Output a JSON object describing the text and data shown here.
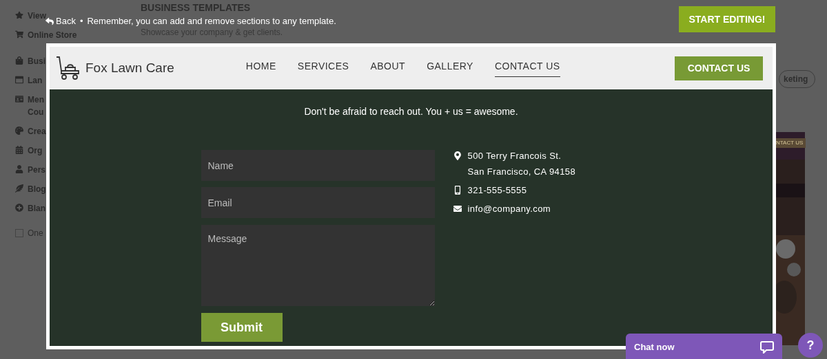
{
  "background": {
    "heading": "BUSINESS TEMPLATES",
    "subheading": "Showcase your company & get clients.",
    "sidebar": [
      {
        "label": "View"
      },
      {
        "label": "Online Store"
      },
      {
        "label": "Busi"
      },
      {
        "label": "Lan"
      },
      {
        "label": "Men\nCou"
      },
      {
        "label": "Crea"
      },
      {
        "label": "Org"
      },
      {
        "label": "Pers"
      },
      {
        "label": "Blog"
      },
      {
        "label": "Blan"
      }
    ],
    "checkbox": {
      "label": "One",
      "checked": false
    },
    "tag": "keting",
    "thumb_button": "NTACT US"
  },
  "topbar": {
    "back": "Back",
    "separator": "•",
    "note": "Remember, you can add and remove sections to any template.",
    "start_button": "START EDITING!"
  },
  "site": {
    "brand": "Fox Lawn Care",
    "nav": [
      {
        "label": "HOME",
        "selected": false
      },
      {
        "label": "SERVICES",
        "selected": false
      },
      {
        "label": "ABOUT",
        "selected": false
      },
      {
        "label": "GALLERY",
        "selected": false
      },
      {
        "label": "CONTACT US",
        "selected": true
      }
    ],
    "cta": "CONTACT US",
    "tagline": "Don't be afraid to reach out. You + us = awesome.",
    "form": {
      "name": {
        "placeholder": "Name"
      },
      "email": {
        "placeholder": "Email"
      },
      "message": {
        "placeholder": "Message"
      },
      "submit": "Submit"
    },
    "contact": [
      {
        "kind": "address",
        "lines": [
          "500 Terry Francois St.",
          "San Francisco, CA 94158"
        ]
      },
      {
        "kind": "phone",
        "lines": [
          "321-555-5555"
        ]
      },
      {
        "kind": "email",
        "lines": [
          "info@company.com"
        ]
      }
    ]
  },
  "chat": {
    "label": "Chat now",
    "help": "?"
  }
}
